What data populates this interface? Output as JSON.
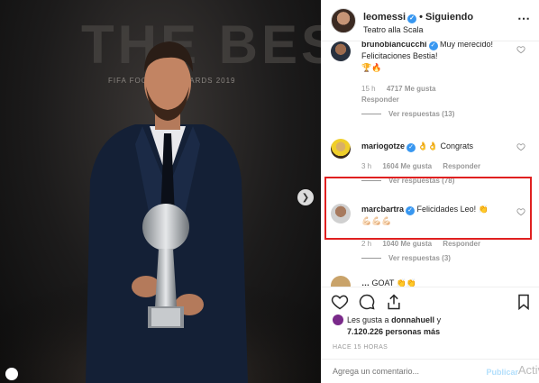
{
  "post": {
    "username": "leomessi",
    "follow_status": "Siguiendo",
    "location": "Teatro alla Scala",
    "background_text": "THE BEST",
    "event_text": "FIFA FOOTBALL AWARDS 2019"
  },
  "comments": [
    {
      "username": "brunobiancucchi",
      "verified": true,
      "text": "Muy merecido! Felicitaciones Bestia!",
      "emoji": "🏆🔥",
      "age": "15 h",
      "likes": "4717 Me gusta",
      "reply_label": "Responder",
      "replies": "Ver respuestas (13)"
    },
    {
      "username": "mariogotze",
      "verified": true,
      "text": "👌👌 Congrats",
      "age": "3 h",
      "likes": "1604 Me gusta",
      "reply_label": "Responder",
      "replies": "Ver respuestas (78)",
      "highlighted": true
    },
    {
      "username": "marcbartra",
      "verified": true,
      "text": "Felicidades Leo! 👏",
      "emoji": "💪🏻💪🏻💪🏻",
      "age": "2 h",
      "likes": "1040 Me gusta",
      "reply_label": "Responder",
      "replies": "Ver respuestas (3)"
    },
    {
      "username": "…",
      "text": "GOAT 👏👏"
    }
  ],
  "likes": {
    "prefix": "Les gusta a",
    "user": "donnahuell",
    "conj": "y",
    "count": "7.120.226 personas más"
  },
  "timestamp": "HACE 15 HORAS",
  "add_comment": {
    "placeholder": "Agrega un comentario...",
    "publish": "Publicar"
  },
  "overlay_text": "Activ",
  "colors": {
    "verified": "#3897f0",
    "highlight": "#e02020",
    "publish": "#b2dffc"
  },
  "icons": [
    "verified-icon",
    "more-icon",
    "heart-icon",
    "comment-icon",
    "share-icon",
    "bookmark-icon",
    "next-arrow-icon"
  ]
}
